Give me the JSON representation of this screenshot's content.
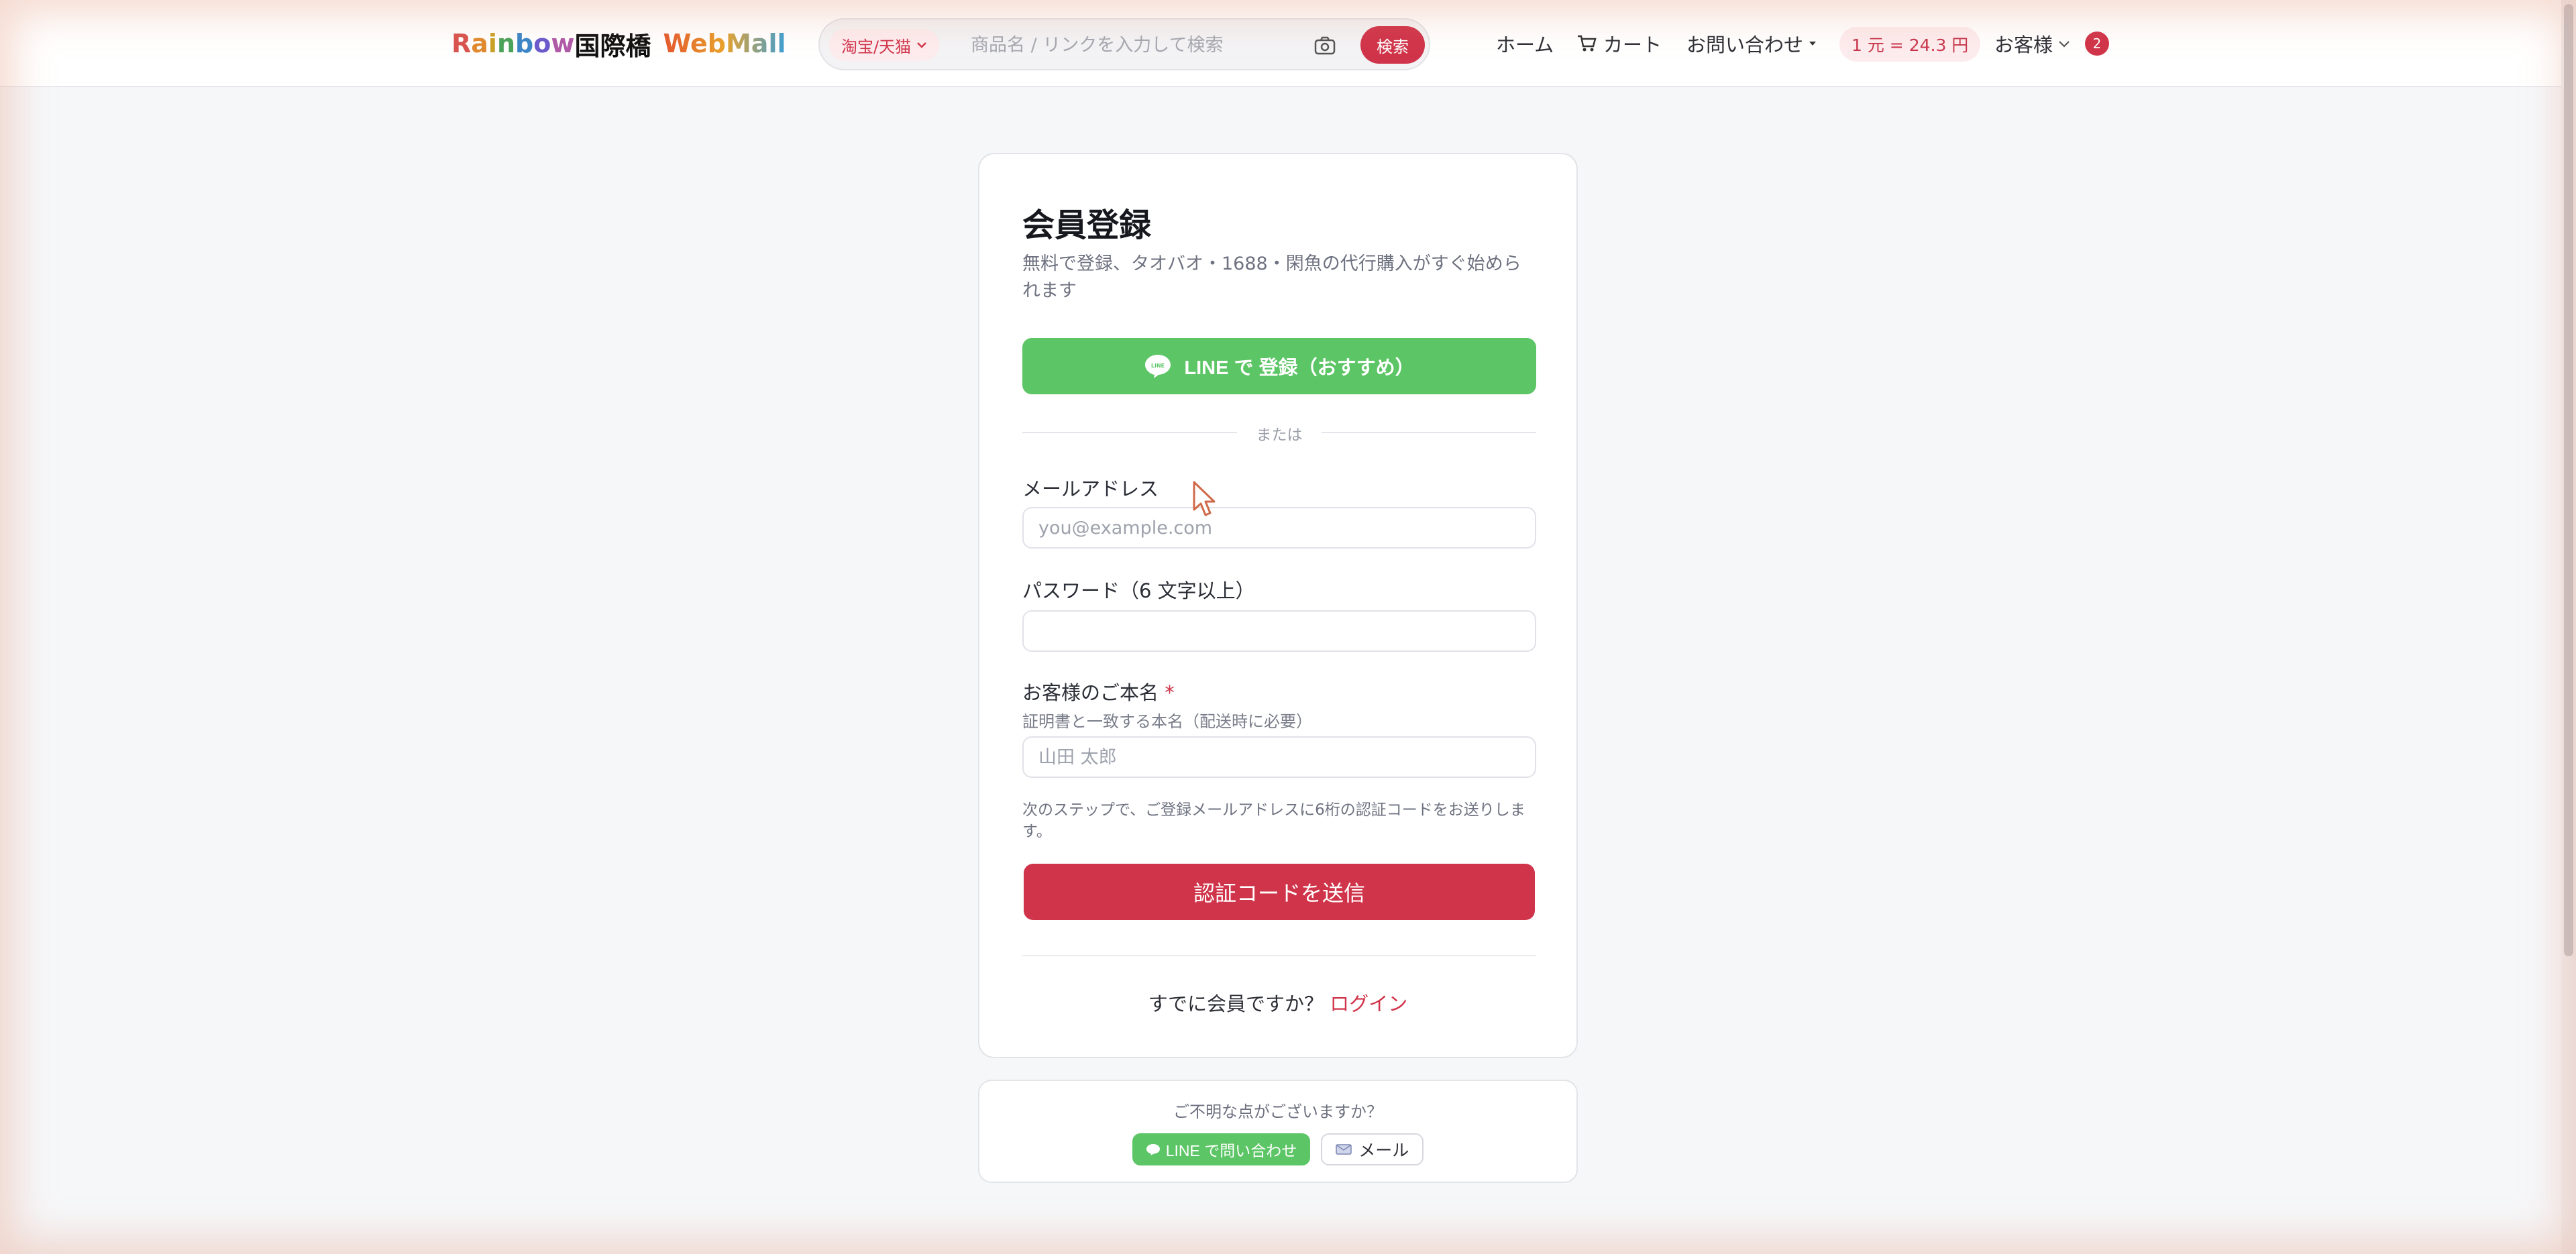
{
  "header": {
    "logo": {
      "rainbow": [
        "R",
        "a",
        "i",
        "n",
        "b",
        "o",
        "w"
      ],
      "kanji": "国際橋",
      "webmall": "WebMall"
    },
    "search": {
      "platform": "淘宝/天猫",
      "placeholder": "商品名 / リンクを入力して検索",
      "button": "検索"
    },
    "nav": {
      "home": "ホーム",
      "cart": "カート",
      "contact": "お問い合わせ",
      "rate": "1 元 = 24.3 円",
      "user": "お客様",
      "notifications": "2"
    }
  },
  "signup": {
    "title": "会員登録",
    "subtitle": "無料で登録、タオバオ・1688・閑魚の代行購入がすぐ始められます",
    "line_button": "LINE で 登録（おすすめ）",
    "divider": "または",
    "email_label": "メールアドレス",
    "email_placeholder": "you@example.com",
    "password_label": "パスワード（6 文字以上）",
    "password_placeholder": "",
    "name_label": "お客様のご本名",
    "name_required": "*",
    "name_hint": "証明書と一致する本名（配送時に必要）",
    "name_placeholder": "山田 太郎",
    "note": "次のステップで、ご登録メールアドレスに6桁の認証コードをお送りします。",
    "submit": "認証コードを送信",
    "login_prompt": "すでに会員ですか？",
    "login_link": "ログイン"
  },
  "help": {
    "question": "ご不明な点がございますか？",
    "line_button": "LINE で問い合わせ",
    "mail_button": "メール"
  },
  "colors": {
    "brand_red": "#d0344a",
    "line_green": "#5cc565"
  },
  "icons": [
    "chevron-down-icon",
    "camera-icon",
    "cart-icon",
    "line-icon",
    "chat-icon",
    "mail-icon",
    "cursor-icon"
  ]
}
